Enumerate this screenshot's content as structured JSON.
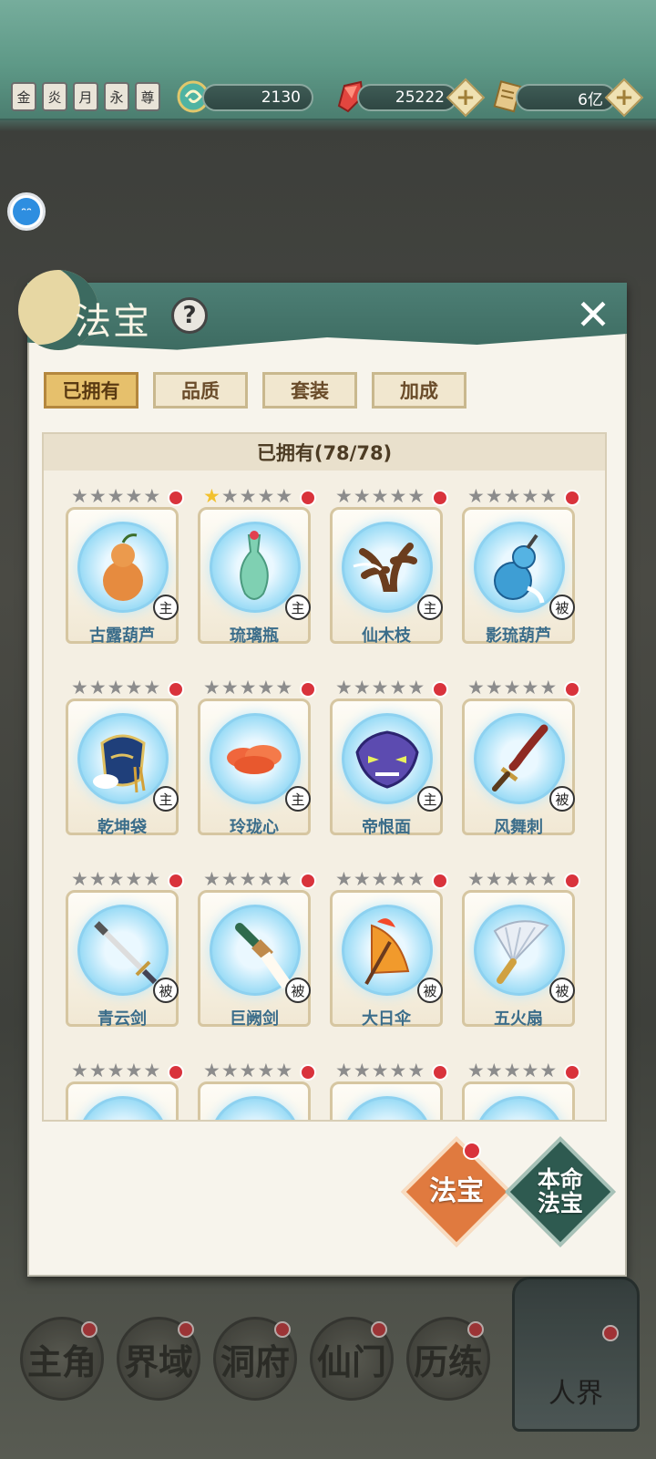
{
  "top_bar": {
    "emblems": [
      "金",
      "炎",
      "月",
      "永",
      "尊"
    ],
    "resources": [
      {
        "icon": "jade-swirl-icon",
        "value": "2130"
      },
      {
        "icon": "red-crystal-icon",
        "value": "25222"
      },
      {
        "icon": "scroll-coin-icon",
        "value": "6亿"
      }
    ],
    "chat_glyph": "ᵔᵔ"
  },
  "panel": {
    "title": "法宝",
    "help": "?",
    "close": "✕",
    "tabs": [
      "已拥有",
      "品质",
      "套装",
      "加成"
    ],
    "list_header": "已拥有(78/78)",
    "items": [
      {
        "name": "古露葫芦",
        "role": "主",
        "stars": 0,
        "art": "gourd"
      },
      {
        "name": "琉璃瓶",
        "role": "主",
        "stars": 1,
        "art": "vase"
      },
      {
        "name": "仙木枝",
        "role": "主",
        "stars": 0,
        "art": "branch"
      },
      {
        "name": "影琉葫芦",
        "role": "被",
        "stars": 0,
        "art": "blue-gourd"
      },
      {
        "name": "乾坤袋",
        "role": "主",
        "stars": 0,
        "art": "bag"
      },
      {
        "name": "玲珑心",
        "role": "主",
        "stars": 0,
        "art": "cloud"
      },
      {
        "name": "帝恨面",
        "role": "主",
        "stars": 0,
        "art": "mask"
      },
      {
        "name": "风舞刺",
        "role": "被",
        "stars": 0,
        "art": "dagger"
      },
      {
        "name": "青云剑",
        "role": "被",
        "stars": 0,
        "art": "sword"
      },
      {
        "name": "巨阙剑",
        "role": "被",
        "stars": 0,
        "art": "broadsword"
      },
      {
        "name": "大日伞",
        "role": "被",
        "stars": 0,
        "art": "umbrella"
      },
      {
        "name": "五火扇",
        "role": "被",
        "stars": 0,
        "art": "fan"
      },
      {
        "name": "",
        "role": "",
        "stars": 0,
        "art": "partial"
      },
      {
        "name": "",
        "role": "",
        "stars": 0,
        "art": "partial"
      },
      {
        "name": "",
        "role": "",
        "stars": 0,
        "art": "partial"
      },
      {
        "name": "",
        "role": "",
        "stars": 0,
        "art": "partial"
      }
    ],
    "buttons": {
      "fabao": "法宝",
      "benming_line1": "本命",
      "benming_line2": "法宝"
    }
  },
  "bottom_nav": [
    "主角",
    "界域",
    "洞府",
    "仙门",
    "历练"
  ],
  "realm_label": "人界"
}
